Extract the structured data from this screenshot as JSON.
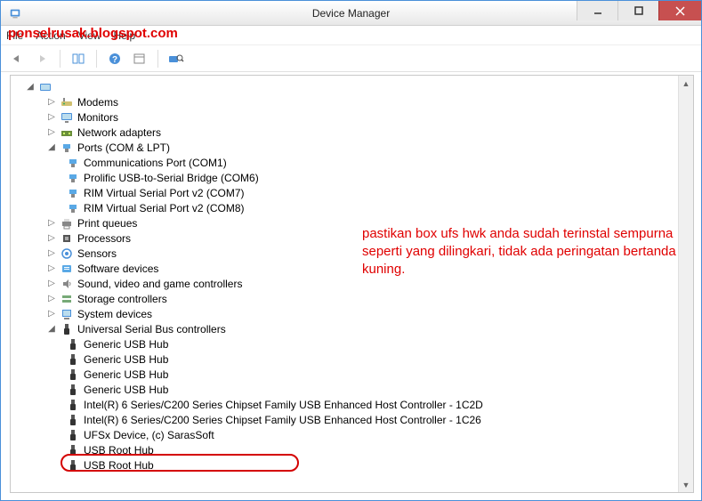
{
  "window": {
    "title": "Device Manager"
  },
  "watermark": "ponselrusak.blogspot.com",
  "menu": {
    "file": "File",
    "action": "Action",
    "view": "View",
    "help": "Help"
  },
  "annotation": "pastikan box ufs hwk anda sudah terinstal sempurna seperti yang dilingkari, tidak ada peringatan bertanda kuning.",
  "icons": {
    "back": "back-arrow",
    "forward": "forward-arrow",
    "grid": "grid-icon",
    "help": "help-icon",
    "props": "properties-icon",
    "computer": "computer-icon"
  },
  "tree": {
    "root": "",
    "nodes": [
      {
        "label": "Modems",
        "expander": "▷",
        "icon": "modem"
      },
      {
        "label": "Monitors",
        "expander": "▷",
        "icon": "monitor"
      },
      {
        "label": "Network adapters",
        "expander": "▷",
        "icon": "network"
      },
      {
        "label": "Ports (COM & LPT)",
        "expander": "◢",
        "icon": "port",
        "children": [
          {
            "label": "Communications Port (COM1)",
            "icon": "port"
          },
          {
            "label": "Prolific USB-to-Serial Bridge (COM6)",
            "icon": "port"
          },
          {
            "label": "RIM Virtual Serial Port v2 (COM7)",
            "icon": "port"
          },
          {
            "label": "RIM Virtual Serial Port v2 (COM8)",
            "icon": "port"
          }
        ]
      },
      {
        "label": "Print queues",
        "expander": "▷",
        "icon": "printer"
      },
      {
        "label": "Processors",
        "expander": "▷",
        "icon": "cpu"
      },
      {
        "label": "Sensors",
        "expander": "▷",
        "icon": "sensor"
      },
      {
        "label": "Software devices",
        "expander": "▷",
        "icon": "software"
      },
      {
        "label": "Sound, video and game controllers",
        "expander": "▷",
        "icon": "sound"
      },
      {
        "label": "Storage controllers",
        "expander": "▷",
        "icon": "storage"
      },
      {
        "label": "System devices",
        "expander": "▷",
        "icon": "system"
      },
      {
        "label": "Universal Serial Bus controllers",
        "expander": "◢",
        "icon": "usb",
        "children": [
          {
            "label": "Generic USB Hub",
            "icon": "usb"
          },
          {
            "label": "Generic USB Hub",
            "icon": "usb"
          },
          {
            "label": "Generic USB Hub",
            "icon": "usb"
          },
          {
            "label": "Generic USB Hub",
            "icon": "usb"
          },
          {
            "label": "Intel(R) 6 Series/C200 Series Chipset Family USB Enhanced Host Controller - 1C2D",
            "icon": "usb"
          },
          {
            "label": "Intel(R) 6 Series/C200 Series Chipset Family USB Enhanced Host Controller - 1C26",
            "icon": "usb"
          },
          {
            "label": "UFSx Device, (c) SarasSoft",
            "icon": "usb",
            "circled": true
          },
          {
            "label": "USB Root Hub",
            "icon": "usb"
          },
          {
            "label": "USB Root Hub",
            "icon": "usb"
          }
        ]
      }
    ]
  }
}
